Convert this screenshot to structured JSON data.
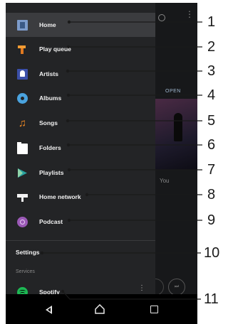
{
  "menu": {
    "items": [
      {
        "label": "Home",
        "icon": "home-icon",
        "active": true
      },
      {
        "label": "Play queue",
        "icon": "play-queue-icon"
      },
      {
        "label": "Artists",
        "icon": "artists-icon"
      },
      {
        "label": "Albums",
        "icon": "albums-icon"
      },
      {
        "label": "Songs",
        "icon": "songs-icon"
      },
      {
        "label": "Folders",
        "icon": "folders-icon"
      },
      {
        "label": "Playlists",
        "icon": "playlists-icon"
      },
      {
        "label": "Home network",
        "icon": "home-network-icon"
      },
      {
        "label": "Podcast",
        "icon": "podcast-icon"
      }
    ],
    "settings_label": "Settings",
    "services_label": "Services",
    "spotify_label": "Spotify"
  },
  "background": {
    "open_label": "OPEN",
    "you_label": "You"
  },
  "nav": {
    "back_icon": "back-icon",
    "home_icon": "home-nav-icon",
    "recent_icon": "recent-apps-icon"
  },
  "callouts": [
    "1",
    "2",
    "3",
    "4",
    "5",
    "6",
    "7",
    "8",
    "9",
    "10",
    "11"
  ],
  "colors": {
    "drawer_bg": "#232426",
    "active_row": "#3b3c3f",
    "accent_orange": "#f08a24",
    "spotify_green": "#1db954"
  }
}
